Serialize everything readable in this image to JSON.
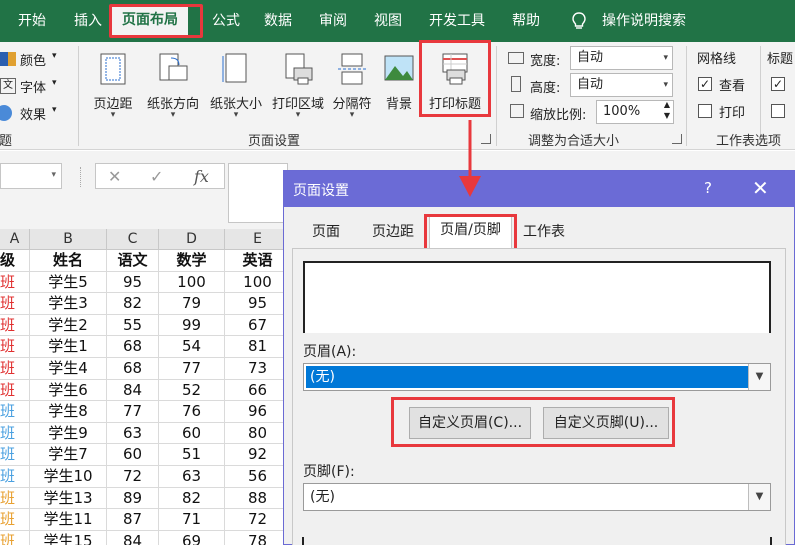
{
  "ribbon_tabs": [
    "开始",
    "插入",
    "页面布局",
    "公式",
    "数据",
    "审阅",
    "视图",
    "开发工具",
    "帮助",
    "操作说明搜索"
  ],
  "active_tab": "页面布局",
  "theme_group": {
    "colors": "颜色",
    "fonts": "字体",
    "effects": "效果",
    "label_partial": "主题"
  },
  "page_setup_group": {
    "label": "页面设置",
    "buttons": [
      "页边距",
      "纸张方向",
      "纸张大小",
      "打印区域",
      "分隔符",
      "背景",
      "打印标题"
    ]
  },
  "scale_group": {
    "label": "调整为合适大小",
    "width_label": "宽度:",
    "width_value": "自动",
    "height_label": "高度:",
    "height_value": "自动",
    "scale_label": "缩放比例:",
    "scale_value": "100%"
  },
  "sheet_options_group": {
    "label": "工作表选项",
    "gridlines": "网格线",
    "headings_partial": "标题",
    "view": "查看",
    "print": "打印",
    "view_checked": true,
    "print_checked": false
  },
  "formula_bar": {
    "cancel_icon": "✕",
    "enter_icon": "✓",
    "fx_icon": "fx"
  },
  "spreadsheet": {
    "columns": [
      "A",
      "B",
      "C",
      "D",
      "E"
    ],
    "header_row": [
      "级",
      "姓名",
      "语文",
      "数学",
      "英语"
    ],
    "rows": [
      [
        "班",
        "学生5",
        "95",
        "100",
        "100"
      ],
      [
        "班",
        "学生3",
        "82",
        "79",
        "95"
      ],
      [
        "班",
        "学生2",
        "55",
        "99",
        "67"
      ],
      [
        "班",
        "学生1",
        "68",
        "54",
        "81"
      ],
      [
        "班",
        "学生4",
        "68",
        "77",
        "73"
      ],
      [
        "班",
        "学生6",
        "84",
        "52",
        "66"
      ],
      [
        "班",
        "学生8",
        "77",
        "76",
        "96"
      ],
      [
        "班",
        "学生9",
        "63",
        "60",
        "80"
      ],
      [
        "班",
        "学生7",
        "60",
        "51",
        "92"
      ],
      [
        "班",
        "学生10",
        "72",
        "63",
        "56"
      ],
      [
        "班",
        "学生13",
        "89",
        "82",
        "88"
      ],
      [
        "班",
        "学生11",
        "87",
        "71",
        "72"
      ],
      [
        "班",
        "学生15",
        "84",
        "69",
        "78"
      ]
    ],
    "class_colors": [
      "#e03030",
      "#e03030",
      "#e03030",
      "#e03030",
      "#e03030",
      "#e03030",
      "#4aa0e0",
      "#4aa0e0",
      "#4aa0e0",
      "#4aa0e0",
      "#e8a030",
      "#e8a030",
      "#e8a030"
    ]
  },
  "dialog": {
    "title": "页面设置",
    "help": "?",
    "close": "✕",
    "tabs": [
      "页面",
      "页边距",
      "页眉/页脚",
      "工作表"
    ],
    "active_tab": "页眉/页脚",
    "header_label": "页眉(A):",
    "header_value": "(无)",
    "custom_header": "自定义页眉(C)...",
    "custom_footer": "自定义页脚(U)...",
    "footer_label": "页脚(F):",
    "footer_value": "(无)"
  },
  "colors": {
    "ribbon_green": "#217346",
    "dialog_title": "#6b6bd6",
    "highlight_red": "#e8383d",
    "selection_blue": "#0078d7"
  }
}
